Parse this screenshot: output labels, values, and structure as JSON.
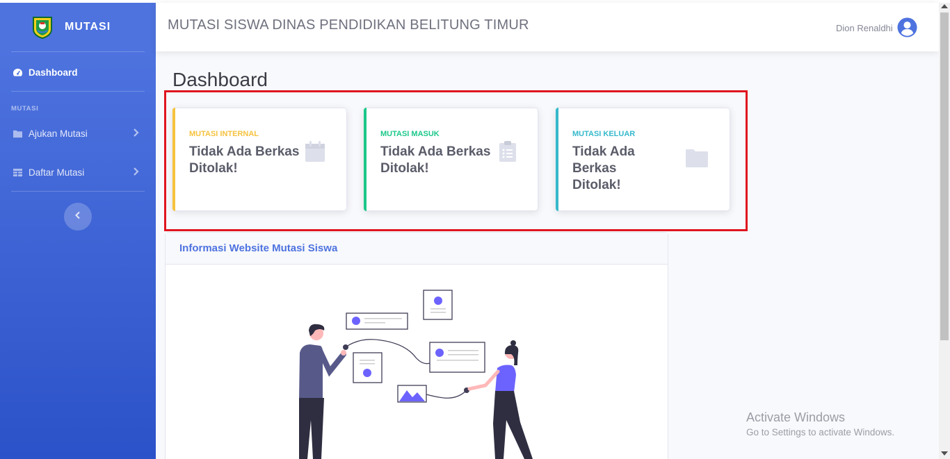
{
  "brand": {
    "name": "MUTASI"
  },
  "sidebar": {
    "dashboard_label": "Dashboard",
    "section_heading": "MUTASI",
    "items": [
      {
        "label": "Ajukan Mutasi"
      },
      {
        "label": "Daftar Mutasi"
      }
    ]
  },
  "topbar": {
    "title": "MUTASI SISWA DINAS PENDIDIKAN BELITUNG TIMUR",
    "user_name": "Dion Renaldhi"
  },
  "page": {
    "title": "Dashboard"
  },
  "cards": [
    {
      "label": "MUTASI INTERNAL",
      "value": "Tidak Ada Berkas Ditolak!",
      "color": "#f6c23e",
      "icon": "calendar-icon"
    },
    {
      "label": "MUTASI MASUK",
      "value": "Tidak Ada Berkas Ditolak!",
      "color": "#1cc88a",
      "icon": "clipboard-list-icon"
    },
    {
      "label": "MUTASI KELUAR",
      "value": "Tidak Ada Berkas Ditolak!",
      "color": "#36b9cc",
      "icon": "folder-icon"
    }
  ],
  "info": {
    "title": "Informasi Website Mutasi Siswa"
  },
  "watermark": {
    "line1": "Activate Windows",
    "line2": "Go to Settings to activate Windows."
  },
  "colors": {
    "primary": "#4e73df",
    "highlight_border": "#e0151f"
  }
}
